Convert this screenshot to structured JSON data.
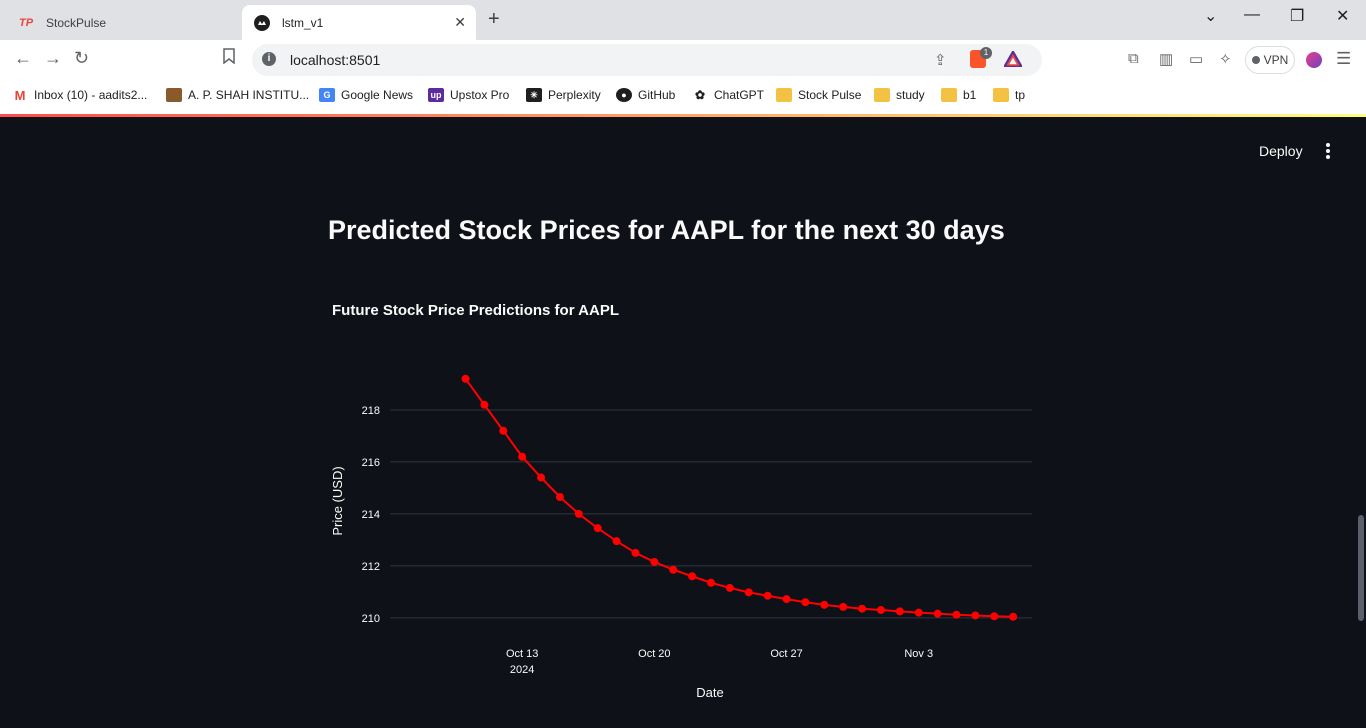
{
  "browser": {
    "tabs": [
      {
        "title": "StockPulse",
        "active": false
      },
      {
        "title": "lstm_v1",
        "active": true
      }
    ],
    "url": "localhost:8501",
    "vpn_label": "VPN",
    "brave_badge": "1",
    "bookmarks": [
      {
        "label": "Inbox (10) - aadits2...",
        "icon": "gmail-icon"
      },
      {
        "label": "A. P. SHAH INSTITU...",
        "icon": "crest-icon"
      },
      {
        "label": "Google News",
        "icon": "google-news-icon"
      },
      {
        "label": "Upstox Pro",
        "icon": "upstox-icon"
      },
      {
        "label": "Perplexity",
        "icon": "perplexity-icon"
      },
      {
        "label": "GitHub",
        "icon": "github-icon"
      },
      {
        "label": "ChatGPT",
        "icon": "chatgpt-icon"
      },
      {
        "label": "Stock Pulse",
        "icon": "folder-icon"
      },
      {
        "label": "study",
        "icon": "folder-icon"
      },
      {
        "label": "b1",
        "icon": "folder-icon"
      },
      {
        "label": "tp",
        "icon": "folder-icon"
      }
    ]
  },
  "app": {
    "deploy_label": "Deploy",
    "heading": "Predicted Stock Prices for AAPL for the next 30 days"
  },
  "colors": {
    "background": "#0e1117",
    "line": "#ff0000",
    "gridline": "#31333f",
    "text": "#fafafa"
  },
  "chart_data": {
    "type": "line",
    "title": "Future Stock Price Predictions for AAPL",
    "xlabel": "Date",
    "ylabel": "Price (USD)",
    "x_ticks": [
      {
        "date": "2024-10-13",
        "label": "Oct 13",
        "sublabel": "2024"
      },
      {
        "date": "2024-10-20",
        "label": "Oct 20",
        "sublabel": ""
      },
      {
        "date": "2024-10-27",
        "label": "Oct 27",
        "sublabel": ""
      },
      {
        "date": "2024-11-03",
        "label": "Nov 3",
        "sublabel": ""
      }
    ],
    "y_ticks": [
      210,
      212,
      214,
      216,
      218
    ],
    "xlim": [
      "2024-10-06",
      "2024-11-09"
    ],
    "ylim": [
      209.3,
      219.5
    ],
    "grid": true,
    "series": [
      {
        "x": [
          "2024-10-10",
          "2024-10-11",
          "2024-10-12",
          "2024-10-13",
          "2024-10-14",
          "2024-10-15",
          "2024-10-16",
          "2024-10-17",
          "2024-10-18",
          "2024-10-19",
          "2024-10-20",
          "2024-10-21",
          "2024-10-22",
          "2024-10-23",
          "2024-10-24",
          "2024-10-25",
          "2024-10-26",
          "2024-10-27",
          "2024-10-28",
          "2024-10-29",
          "2024-10-30",
          "2024-10-31",
          "2024-11-01",
          "2024-11-02",
          "2024-11-03",
          "2024-11-04",
          "2024-11-05",
          "2024-11-06",
          "2024-11-07",
          "2024-11-08"
        ],
        "values": [
          219.2,
          218.2,
          217.2,
          216.2,
          215.4,
          214.65,
          214.0,
          213.45,
          212.95,
          212.5,
          212.15,
          211.85,
          211.6,
          211.35,
          211.15,
          210.98,
          210.85,
          210.72,
          210.6,
          210.5,
          210.42,
          210.35,
          210.3,
          210.25,
          210.2,
          210.16,
          210.12,
          210.09,
          210.06,
          210.04
        ]
      }
    ]
  }
}
